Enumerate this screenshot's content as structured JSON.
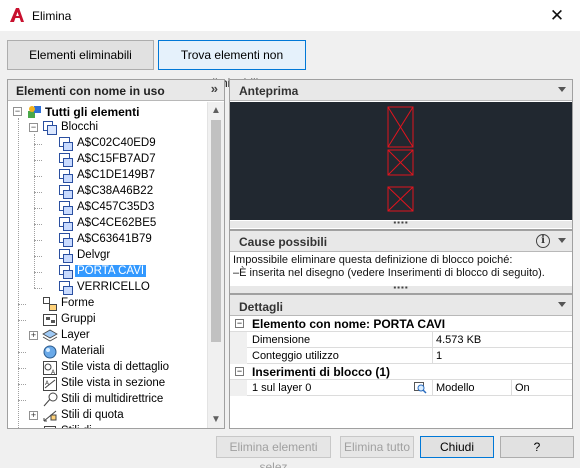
{
  "window": {
    "title": "Elimina",
    "close_glyph": "✕",
    "brand_color": "#c8102e"
  },
  "mode_buttons": {
    "purgeable": "Elementi eliminabili",
    "non_purgeable": "Trova elementi non eliminabili"
  },
  "left_panel": {
    "title": "Elementi con nome in uso",
    "tree": [
      {
        "label": "Tutti gli elementi",
        "icon": "all-items-icon",
        "level": 0,
        "expander": "−",
        "bold": true
      },
      {
        "label": "Blocchi",
        "icon": "blocks-icon",
        "level": 1,
        "expander": "−"
      },
      {
        "label": "A$C02C40ED9",
        "icon": "block-icon",
        "level": 2
      },
      {
        "label": "A$C15FB7AD7",
        "icon": "block-icon",
        "level": 2
      },
      {
        "label": "A$C1DE149B7",
        "icon": "block-icon",
        "level": 2
      },
      {
        "label": "A$C38A46B22",
        "icon": "block-icon",
        "level": 2
      },
      {
        "label": "A$C457C35D3",
        "icon": "block-icon",
        "level": 2
      },
      {
        "label": "A$C4CE62BE5",
        "icon": "block-icon",
        "level": 2
      },
      {
        "label": "A$C63641B79",
        "icon": "block-icon",
        "level": 2
      },
      {
        "label": "Delvgr",
        "icon": "block-icon",
        "level": 2
      },
      {
        "label": "PORTA CAVI",
        "icon": "block-icon",
        "level": 2,
        "selected": true
      },
      {
        "label": "VERRICELLO",
        "icon": "block-icon",
        "level": 2
      },
      {
        "label": "Forme",
        "icon": "shapes-icon",
        "level": 1
      },
      {
        "label": "Gruppi",
        "icon": "groups-icon",
        "level": 1
      },
      {
        "label": "Layer",
        "icon": "layers-icon",
        "level": 1,
        "expander": "+"
      },
      {
        "label": "Materiali",
        "icon": "materials-icon",
        "level": 1
      },
      {
        "label": "Stile vista di dettaglio",
        "icon": "detail-view-style-icon",
        "level": 1
      },
      {
        "label": "Stile vista in sezione",
        "icon": "section-view-style-icon",
        "level": 1
      },
      {
        "label": "Stili di multidirettrice",
        "icon": "multileader-style-icon",
        "level": 1
      },
      {
        "label": "Stili di quota",
        "icon": "dimension-style-icon",
        "level": 1,
        "expander": "+"
      },
      {
        "label": "Stili di ...",
        "icon": "style-icon",
        "level": 1
      }
    ]
  },
  "preview": {
    "title": "Anteprima"
  },
  "causes": {
    "title": "Cause possibili",
    "info_glyph": "i",
    "lines": [
      "Impossibile eliminare questa definizione di blocco poiché:",
      "–È inserita nel disegno (vedere Inserimenti di blocco di seguito)."
    ]
  },
  "details": {
    "title": "Dettagli",
    "category1": "Elemento con nome: PORTA CAVI",
    "rows": [
      {
        "label": "Dimensione",
        "value": "4.573 KB"
      },
      {
        "label": "Conteggio utilizzo",
        "value": "1"
      }
    ],
    "category2": "Inserimenti di blocco (1)",
    "insert_row": {
      "label": "1 sul layer 0",
      "space": "Modello",
      "state": "On"
    }
  },
  "footer": {
    "purge_selected": "Elimina elementi selez",
    "purge_all": "Elimina tutto",
    "close": "Chiudi",
    "help": "?"
  }
}
